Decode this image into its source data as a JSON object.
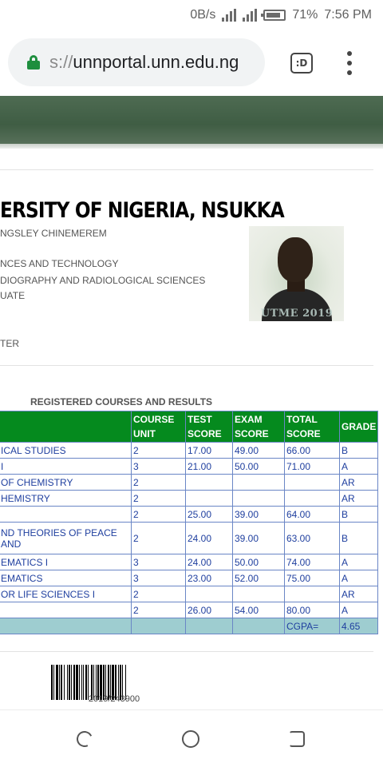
{
  "status_bar": {
    "speed": "0B/s",
    "battery": "71%",
    "time": "7:56 PM"
  },
  "browser": {
    "url_scheme": "s://",
    "url_host": "unnportal.unn.edu.ng",
    "tab_label": ":D"
  },
  "header": {
    "university": "ERSITY OF NIGERIA, NSUKKA",
    "name": "NGSLEY CHINEMEREM",
    "faculty": "NCES AND TECHNOLOGY",
    "department": "DIOGRAPHY AND RADIOLOGICAL SCIENCES",
    "level": "UATE",
    "semester": "TER"
  },
  "photo": {
    "watermark": "UTME 2019"
  },
  "results": {
    "title": "REGISTERED COURSES AND RESULTS",
    "headers": [
      "",
      "COURSE UNIT",
      "TEST SCORE",
      "EXAM SCORE",
      "TOTAL SCORE",
      "GRADE"
    ],
    "rows": [
      [
        "ICAL STUDIES",
        "2",
        "17.00",
        "49.00",
        "66.00",
        "B"
      ],
      [
        "I",
        "3",
        "21.00",
        "50.00",
        "71.00",
        "A"
      ],
      [
        "OF CHEMISTRY",
        "2",
        "",
        "",
        "",
        "AR"
      ],
      [
        "HEMISTRY",
        "2",
        "",
        "",
        "",
        "AR"
      ],
      [
        "",
        "2",
        "25.00",
        "39.00",
        "64.00",
        "B"
      ],
      [
        "ND THEORIES OF PEACE AND",
        "2",
        "24.00",
        "39.00",
        "63.00",
        "B"
      ],
      [
        "EMATICS I",
        "3",
        "24.00",
        "50.00",
        "74.00",
        "A"
      ],
      [
        "EMATICS",
        "3",
        "23.00",
        "52.00",
        "75.00",
        "A"
      ],
      [
        "OR LIFE SCIENCES I",
        "2",
        "",
        "",
        "",
        "AR"
      ],
      [
        "",
        "2",
        "26.00",
        "54.00",
        "80.00",
        "A"
      ]
    ],
    "cgpa_label": "CGPA=",
    "cgpa_value": "4.65"
  },
  "barcode": {
    "number": "2019/243900"
  }
}
